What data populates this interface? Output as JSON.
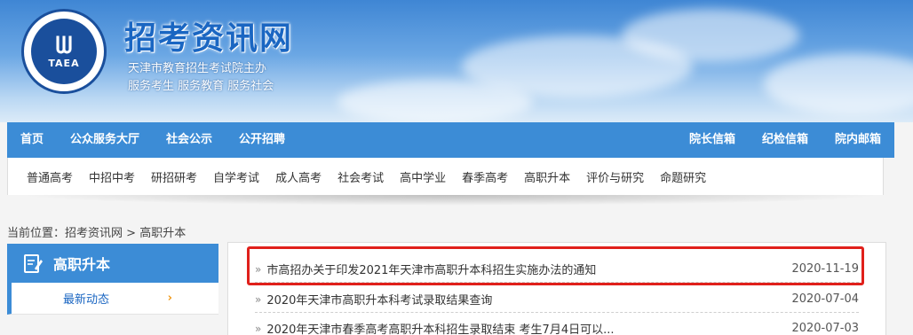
{
  "header": {
    "logo_text": "TAEA",
    "site_title": "招考资讯网",
    "subtitle_1": "天津市教育招生考试院主办",
    "subtitle_2": "服务考生 服务教育 服务社会"
  },
  "main_nav": {
    "left": [
      "首页",
      "公众服务大厅",
      "社会公示",
      "公开招聘"
    ],
    "right": [
      "院长信箱",
      "纪检信箱",
      "院内邮箱"
    ]
  },
  "sub_nav": [
    "普通高考",
    "中招中考",
    "研招研考",
    "自学考试",
    "成人高考",
    "社会考试",
    "高中学业",
    "春季高考",
    "高职升本",
    "评价与研究",
    "命题研究"
  ],
  "breadcrumb": {
    "prefix": "当前位置：",
    "home": "招考资讯网",
    "sep": ">",
    "current": "高职升本"
  },
  "sidebar": {
    "title": "高职升本",
    "icon": "document-edit-icon",
    "items": [
      {
        "label": "最新动态",
        "icon": "chevron-right-icon"
      }
    ]
  },
  "news": [
    {
      "bullet": "»",
      "title": "市高招办关于印发2021年天津市高职升本科招生实施办法的通知",
      "date": "2020-11-19",
      "highlighted": true
    },
    {
      "bullet": "»",
      "title": "2020年天津市高职升本科考试录取结果查询",
      "date": "2020-07-04"
    },
    {
      "bullet": "»",
      "title": "2020年天津市春季高考高职升本科招生录取结束 考生7月4日可以...",
      "date": "2020-07-03"
    }
  ],
  "colors": {
    "nav_blue": "#3c8cd6",
    "highlight_red": "#e0201b",
    "chevron_orange": "#f19a1a"
  }
}
